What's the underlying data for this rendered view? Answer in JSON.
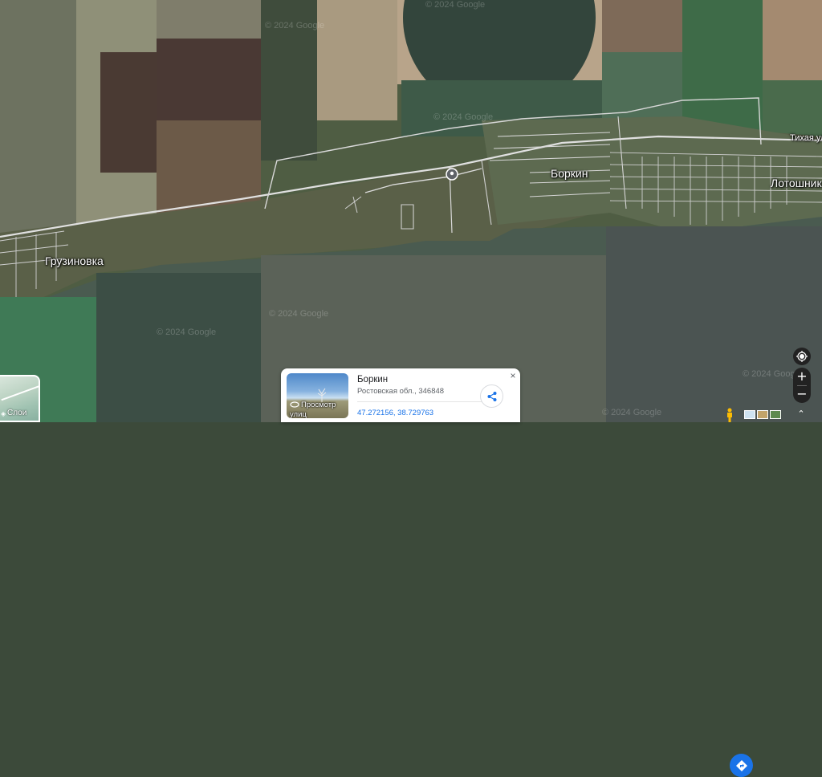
{
  "map": {
    "labels": {
      "gruzinovka": "Грузиновка",
      "borkin": "Боркин",
      "lotoshniki": "Лотошник",
      "tikhaya": "Тихая ул"
    },
    "watermark": "© 2024 Google",
    "water_color": "#4a5b50",
    "field_color": "#5e6e54"
  },
  "layers": {
    "label": "Слои",
    "icon": "layers-icon"
  },
  "place_card": {
    "title": "Боркин",
    "address": "Ростовская обл., 346848",
    "coordinates": "47.272156, 38.729763",
    "street_view_label": "Просмотр улиц",
    "directions_icon": "directions-icon",
    "share_icon": "share-icon",
    "close_label": "×"
  },
  "controls": {
    "locate_icon": "my-location-icon",
    "zoom_in": "+",
    "zoom_out": "−",
    "pegman_icon": "pegman-icon",
    "collapse_label": "⌃"
  },
  "colors": {
    "accent": "#1a73e8",
    "control_bg": "#222222",
    "road": "#e8e8e8"
  }
}
